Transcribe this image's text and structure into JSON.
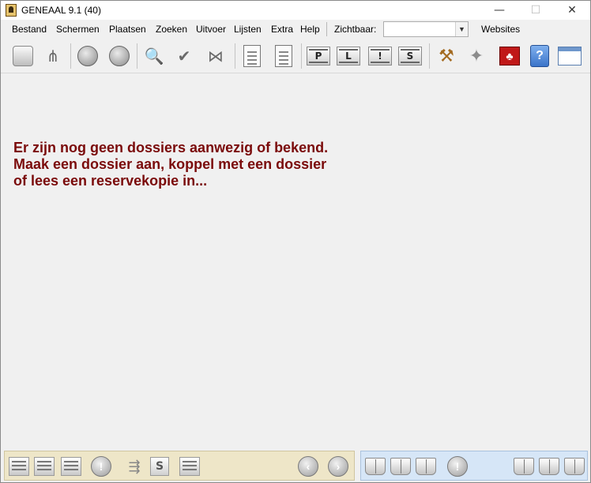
{
  "window": {
    "title": "GENEAAL 9.1 (40)",
    "controls": {
      "minimize": "—",
      "maximize": "☐",
      "close": "✕"
    }
  },
  "menu": {
    "items": [
      "Bestand",
      "Schermen",
      "Plaatsen",
      "Zoeken",
      "Uitvoer",
      "Lijsten",
      "Extra",
      "Help"
    ],
    "zichtbaar_label": "Zichtbaar:",
    "zichtbaar_value": "",
    "websites": "Websites"
  },
  "toolbar": {
    "letters": {
      "p": "P",
      "l": "L",
      "excl": "!",
      "s": "S"
    },
    "help_glyph": "?"
  },
  "main": {
    "notice_lines": [
      "Er zijn nog geen dossiers aanwezig of bekend.",
      "Maak een dossier aan, koppel met een dossier",
      "of lees een reservekopie in..."
    ]
  },
  "bottom": {
    "excl": "!",
    "s_label": "S"
  },
  "colors": {
    "notice_text": "#7a0a0a",
    "bottom_left_bg": "#eee6c8",
    "bottom_right_bg": "#d6e6f7"
  }
}
